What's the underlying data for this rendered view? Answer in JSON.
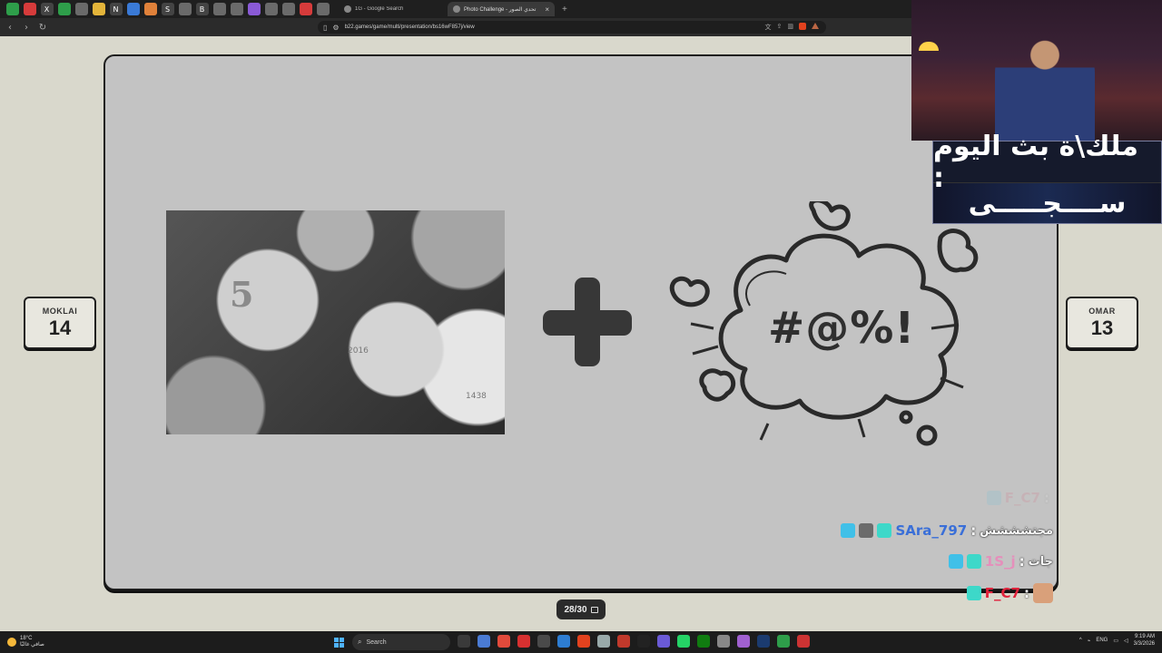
{
  "browser": {
    "pinned_tabs": [
      "green",
      "red",
      "X",
      "green",
      "gray",
      "yellow",
      "N",
      "blue",
      "orange",
      "S",
      "gray",
      "B",
      "gray",
      "gray",
      "purple",
      "gray",
      "gray",
      "red",
      "gray"
    ],
    "tabs": [
      {
        "title": "1G - Google Search",
        "active": false
      },
      {
        "title": "Photo Challenge - تحدي الصور",
        "active": true
      }
    ],
    "new_tab_label": "+",
    "url": "b22.games/game/multi/presentation/bs16wF857j/view"
  },
  "scores": {
    "left": {
      "name": "MOKLAI",
      "value": "14"
    },
    "right": {
      "name": "OMAR",
      "value": "13"
    }
  },
  "slide": {
    "coin_numerals": [
      "5",
      "2016",
      "1438"
    ],
    "curse_symbol": "#@%!",
    "pager": "28/30"
  },
  "stream_overlay": {
    "banner_title": "ملك\\ة بث اليوم :",
    "banner_name": "ســــجـــــى"
  },
  "chat": [
    {
      "user": "F_C7",
      "message": "",
      "user_color": "#e23b5b",
      "faded": true
    },
    {
      "user": "SAra_797",
      "message": "مجتشششش",
      "user_color": "#3a6fd8",
      "faded": false
    },
    {
      "user": "1S_j",
      "message": "جات",
      "user_color": "#e58fbb",
      "faded": false
    },
    {
      "user": "F_C7",
      "message": "",
      "user_color": "#e0223b",
      "faded": false
    }
  ],
  "taskbar": {
    "weather_temp": "18°C",
    "weather_desc": "صافي غالبًا",
    "search_placeholder": "Search",
    "language": "ENG",
    "time": "9:19 AM",
    "date": "3/3/2026"
  }
}
